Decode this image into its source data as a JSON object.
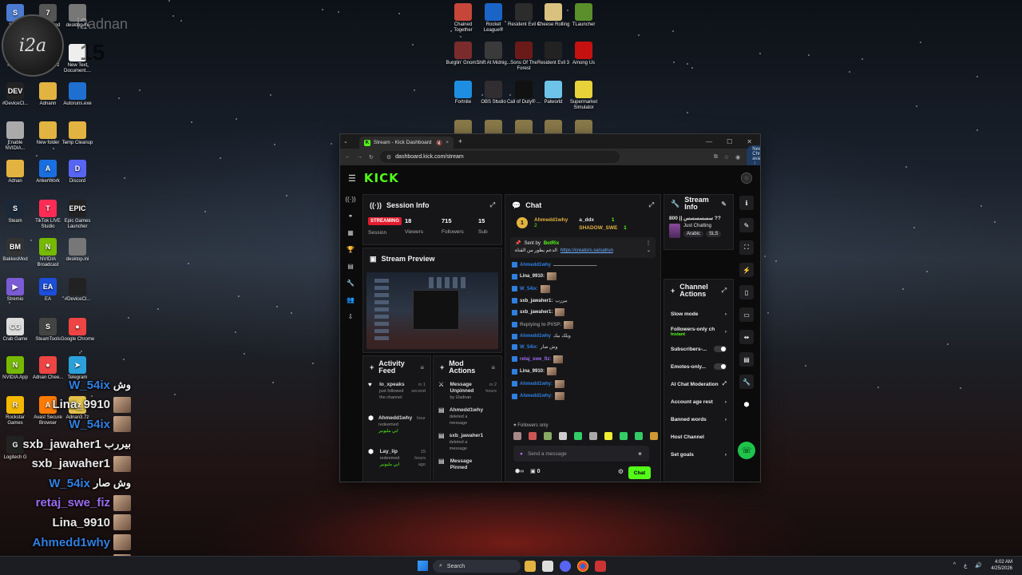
{
  "desktop": {
    "left_icons": [
      {
        "label": "Safari",
        "color": "#4b7bd1",
        "glyph": "S"
      },
      {
        "label": "One-armed robber",
        "color": "#555",
        "glyph": "7"
      },
      {
        "label": "desktop.ini",
        "color": "#777",
        "glyph": ""
      },
      {
        "label": "hidusbf",
        "color": "#e3b341",
        "glyph": ""
      },
      {
        "label": "Adnann.7z",
        "color": "#e3c24a",
        "glyph": "7z"
      },
      {
        "label": "New Text Document....",
        "color": "#eee",
        "glyph": ""
      },
      {
        "label": "#DeviceCl...",
        "color": "#222",
        "glyph": "DEV"
      },
      {
        "label": "Adnann",
        "color": "#e3b341",
        "glyph": ""
      },
      {
        "label": "Autoruns.exe",
        "color": "#1f6fd0",
        "glyph": ""
      },
      {
        "label": "Enable NVIDIA...",
        "color": "#aaa",
        "glyph": ""
      },
      {
        "label": "New folder",
        "color": "#e3b341",
        "glyph": ""
      },
      {
        "label": "Temp Cleanup",
        "color": "#e3b341",
        "glyph": ""
      },
      {
        "label": "Adnan",
        "color": "#e3b341",
        "glyph": ""
      },
      {
        "label": "AnkerWork",
        "color": "#1a6fe0",
        "glyph": "A"
      },
      {
        "label": "Discord",
        "color": "#5865f2",
        "glyph": "D"
      },
      {
        "label": "Steam",
        "color": "#1b2838",
        "glyph": "S"
      },
      {
        "label": "TikTok LIVE Studio",
        "color": "#fe2c55",
        "glyph": "T"
      },
      {
        "label": "Epic Games Launcher",
        "color": "#222",
        "glyph": "EPIC"
      },
      {
        "label": "BakkesMod",
        "color": "#333",
        "glyph": "BM"
      },
      {
        "label": "NVIDIA Broadcast",
        "color": "#76b900",
        "glyph": "N"
      },
      {
        "label": "desktop.ini",
        "color": "#777",
        "glyph": ""
      },
      {
        "label": "Stremio",
        "color": "#7b5bd6",
        "glyph": "▶"
      },
      {
        "label": "EA",
        "color": "#1d4ed8",
        "glyph": "EA"
      },
      {
        "label": "#DeviceCl...",
        "color": "#222",
        "glyph": ""
      },
      {
        "label": "Crab Game",
        "color": "#ddd",
        "glyph": "CG"
      },
      {
        "label": "SteamTools",
        "color": "#444",
        "glyph": "S"
      },
      {
        "label": "Google Chrome",
        "color": "#e44",
        "glyph": "●"
      },
      {
        "label": "NVIDIA App",
        "color": "#76b900",
        "glyph": "N"
      },
      {
        "label": "Adnan Chee...",
        "color": "#e44",
        "glyph": "●"
      },
      {
        "label": "Telegram",
        "color": "#2aa1da",
        "glyph": "➤"
      },
      {
        "label": "Rockstar Games",
        "color": "#f5b800",
        "glyph": "R"
      },
      {
        "label": "Avast Secure Browser",
        "color": "#ff7a00",
        "glyph": "A"
      },
      {
        "label": "Adnan3.7z",
        "color": "#e3c24a",
        "glyph": "7z"
      },
      {
        "label": "Logitech G",
        "color": "#222",
        "glyph": "G"
      }
    ],
    "top_icons": [
      {
        "label": "Chained Together",
        "color": "#c7463a"
      },
      {
        "label": "Rocket League®",
        "color": "#1b64c7"
      },
      {
        "label": "Resident Evil 4",
        "color": "#2c2c2c"
      },
      {
        "label": "Cheese Rolling",
        "color": "#d9c280"
      },
      {
        "label": "TLauncher",
        "color": "#5a8f2c"
      },
      {
        "label": "Burglin' Gnom...",
        "color": "#7a2c2c"
      },
      {
        "label": "Shift At Midnig...",
        "color": "#3a3a3a"
      },
      {
        "label": "Sons Of The Forest",
        "color": "#6b1a1a"
      },
      {
        "label": "Resident Evil 3",
        "color": "#222"
      },
      {
        "label": "Among Us",
        "color": "#c51111"
      },
      {
        "label": "Fortnite",
        "color": "#1e8fe0"
      },
      {
        "label": "OBS Studio",
        "color": "#302e31"
      },
      {
        "label": "Call of Duty® ...",
        "color": "#111"
      },
      {
        "label": "Palworld",
        "color": "#6ec3e8"
      },
      {
        "label": "Supermarket Simulator",
        "color": "#e8d23a"
      }
    ]
  },
  "overlay": {
    "logo_text": "i2a",
    "username": "i2adnan",
    "count": "15",
    "chat": [
      {
        "name": "W_54ix",
        "msg": "وش",
        "style": "blue",
        "thumb": false
      },
      {
        "name": "Lina_9910",
        "msg": "",
        "style": "white",
        "thumb": true
      },
      {
        "name": "W_54ix",
        "msg": "",
        "style": "blue",
        "thumb": true
      },
      {
        "name": "sxb_jawaher1",
        "msg": "بيررب",
        "style": "white",
        "thumb": false
      },
      {
        "name": "sxb_jawaher1",
        "msg": "",
        "style": "white",
        "thumb": true
      },
      {
        "name": "W_54ix",
        "msg": "وش صار",
        "style": "blue",
        "thumb": false
      },
      {
        "name": "retaj_swe_fiz",
        "msg": "",
        "style": "purple",
        "thumb": true
      },
      {
        "name": "Lina_9910",
        "msg": "",
        "style": "white",
        "thumb": true
      },
      {
        "name": "Ahmedd1why",
        "msg": "",
        "style": "blue",
        "thumb": true
      },
      {
        "name": "Ahmedd1why",
        "msg": "",
        "style": "blue",
        "thumb": true
      }
    ]
  },
  "browser": {
    "tab_title": "Stream - Kick Dashboard",
    "url": "dashboard.kick.com/stream",
    "update_label": "New Chrome available"
  },
  "kick": {
    "logo": "KICK",
    "session": {
      "title": "Session Info",
      "live_badge": "STREAMING",
      "session_label": "Session",
      "viewers_value": "18",
      "viewers_label": "Viewers",
      "followers_value": "715",
      "followers_label": "Followers",
      "subs_value": "15",
      "subs_label": "Sub"
    },
    "preview": {
      "title": "Stream Preview"
    },
    "activity": {
      "title": "Activity Feed",
      "items": [
        {
          "user": "lo_xpeaks",
          "sub": "just followed the channel",
          "extra": "",
          "time": "in 1 second",
          "icon": "♥"
        },
        {
          "user": "Ahmedd1why",
          "sub": "redeemed",
          "extra": "ابي مليونير",
          "time": "hour",
          "icon": "⬢"
        },
        {
          "user": "Lay_lip",
          "sub": "redeemed",
          "extra": "ابي مليونير",
          "time": "15 hours ago",
          "icon": "⬢"
        }
      ]
    },
    "mod": {
      "title": "Mod Actions",
      "items": [
        {
          "user": "Message Unpinned",
          "sub": "by i2adnan",
          "time": "in 2 hours"
        },
        {
          "user": "Ahmedd1why",
          "sub": "deleted a message",
          "time": ""
        },
        {
          "user": "sxb_jawaher1",
          "sub": "deleted a message",
          "time": ""
        },
        {
          "user": "Message Pinned",
          "sub": "",
          "time": ""
        }
      ]
    },
    "chat": {
      "title": "Chat",
      "top_gifters": [
        {
          "rank": "1",
          "name": "Ahmedd1why",
          "count": "2"
        },
        {
          "rank": "",
          "name": "a_ddx",
          "count": "1"
        },
        {
          "rank": "",
          "name": "SHADOW_SWE",
          "count": "1"
        }
      ],
      "pinned_by": "Sent by",
      "pinned_bot": "BotRix",
      "pinned_text": "الدعم يطور من القناة",
      "pinned_link": "https://creators.sa/satrun",
      "messages": [
        {
          "name": "Ahmedd1why",
          "text": "ـــــــــــــــــــــــــــــــ",
          "color": "#2f7fe0"
        },
        {
          "name": "Lina_9910:",
          "text": "",
          "color": "#e8e8e8"
        },
        {
          "name": "W_54ix:",
          "text": "",
          "color": "#2f7fe0"
        },
        {
          "name": "sxb_jawaher1:",
          "text": "بيررب",
          "color": "#e8e8e8"
        },
        {
          "name": "sxb_jawaher1:",
          "text": "",
          "color": "#e8e8e8"
        },
        {
          "name": "Replying to PVSP:",
          "text": "",
          "color": "#888888"
        },
        {
          "name": "Ahmedd1why",
          "text": "ويلك بيك",
          "color": "#2f7fe0"
        },
        {
          "name": "W_54ix:",
          "text": "وش صار",
          "color": "#2f7fe0"
        },
        {
          "name": "retaj_swe_fiz:",
          "text": "",
          "color": "#9b6cf0"
        },
        {
          "name": "Lina_9910:",
          "text": "",
          "color": "#e8e8e8"
        },
        {
          "name": "Ahmedd1why:",
          "text": "",
          "color": "#2f7fe0"
        },
        {
          "name": "Ahmedd1why:",
          "text": "",
          "color": "#2f7fe0"
        }
      ],
      "followers_only": "Followers only",
      "input_placeholder": "Send a message",
      "send_label": "Chat",
      "points": "0"
    },
    "stream_info": {
      "title": "Stream Info",
      "stream_title": "سسسسسس || 800 ??",
      "category": "Just Chatting",
      "tags": [
        "Arabic",
        "SLS"
      ]
    },
    "channel_actions": {
      "title": "Channel Actions",
      "items": [
        {
          "label": "Slow mode",
          "sub": "",
          "type": "chev"
        },
        {
          "label": "Followers-only ch",
          "sub": "Instant",
          "type": "chev"
        },
        {
          "label": "Subscribers-...",
          "sub": "",
          "type": "toggle"
        },
        {
          "label": "Emotes-only...",
          "sub": "",
          "type": "toggle"
        },
        {
          "label": "AI Chat Moderation",
          "sub": "",
          "type": "ext"
        },
        {
          "label": "Account age rest",
          "sub": "",
          "type": "chev"
        },
        {
          "label": "Banned words",
          "sub": "",
          "type": "chev"
        },
        {
          "label": "Host Channel",
          "sub": "",
          "type": "none"
        },
        {
          "label": "Set goals",
          "sub": "",
          "type": "chev"
        }
      ]
    }
  },
  "taskbar": {
    "search_placeholder": "Search",
    "time": "4:02 AM",
    "date": "4/25/2026",
    "lang": "ع"
  },
  "colors": {
    "kick_green": "#53fc18",
    "live_red": "#e11d2e"
  }
}
